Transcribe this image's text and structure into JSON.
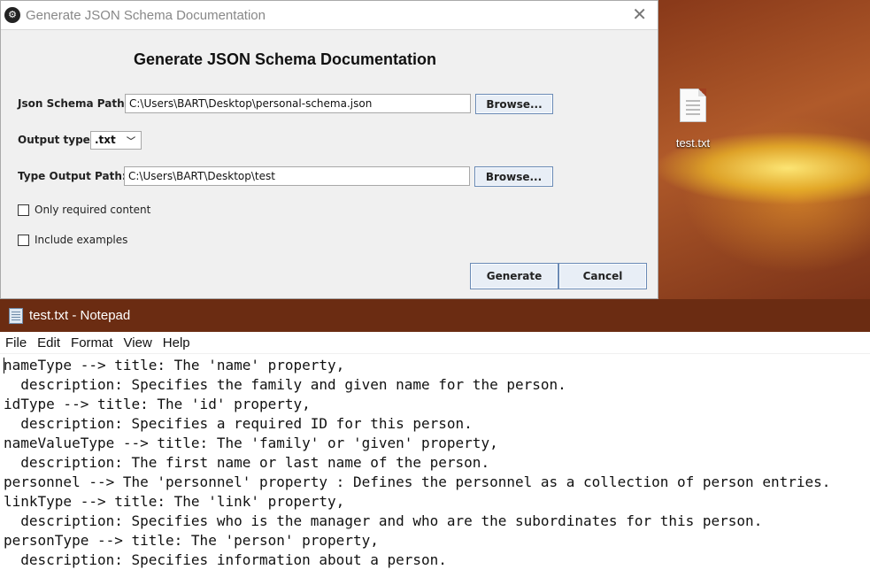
{
  "desktop": {
    "icon_label": "test.txt"
  },
  "dialog": {
    "window_title": "Generate JSON Schema Documentation",
    "heading": "Generate JSON Schema Documentation",
    "schema_path_label": "Json Schema Path:",
    "schema_path_value": "C:\\Users\\BART\\Desktop\\personal-schema.json",
    "browse_label": "Browse...",
    "output_type_label": "Output type",
    "output_type_value": ".txt",
    "output_path_label": "Type Output Path:",
    "output_path_value": "C:\\Users\\BART\\Desktop\\test",
    "only_required_label": "Only required content",
    "only_required_checked": false,
    "include_examples_label": "Include examples",
    "include_examples_checked": false,
    "generate_label": "Generate",
    "cancel_label": "Cancel"
  },
  "notepad": {
    "window_title": "test.txt - Notepad",
    "menu": [
      "File",
      "Edit",
      "Format",
      "View",
      "Help"
    ],
    "lines": [
      "nameType --> title: The 'name' property,",
      "  description: Specifies the family and given name for the person.",
      "idType --> title: The 'id' property,",
      "  description: Specifies a required ID for this person.",
      "nameValueType --> title: The 'family' or 'given' property,",
      "  description: The first name or last name of the person.",
      "personnel --> The 'personnel' property : Defines the personnel as a collection of person entries.",
      "linkType --> title: The 'link' property,",
      "  description: Specifies who is the manager and who are the subordinates for this person.",
      "personType --> title: The 'person' property,",
      "  description: Specifies information about a person."
    ]
  }
}
